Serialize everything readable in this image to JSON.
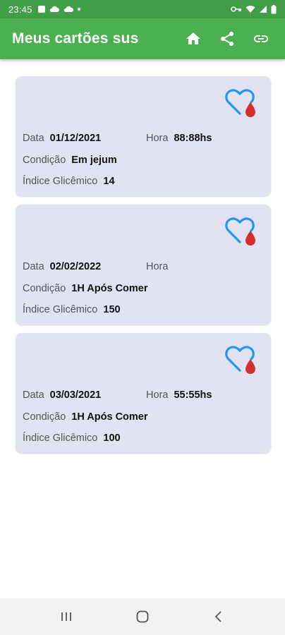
{
  "status_bar": {
    "time": "23:45",
    "icons": [
      "image-icon",
      "cloud-off-icon",
      "cloud-icon",
      "dot-icon",
      "vpn-key-icon",
      "wifi-icon",
      "signal-icon",
      "battery-icon"
    ]
  },
  "app_bar": {
    "title": "Meus cartões sus",
    "actions": [
      "home-icon",
      "share-icon",
      "link-icon"
    ]
  },
  "labels": {
    "data": "Data",
    "hora": "Hora",
    "condicao": "Condição",
    "indice": "Índice Glicêmico"
  },
  "cards": [
    {
      "data": "01/12/2021",
      "hora": "88:88hs",
      "condicao": "Em jejum",
      "indice": "14"
    },
    {
      "data": "02/02/2022",
      "hora": "",
      "condicao": "1H Após Comer",
      "indice": "150"
    },
    {
      "data": "03/03/2021",
      "hora": "55:55hs",
      "condicao": "1H Após Comer",
      "indice": "100"
    }
  ],
  "colors": {
    "app_bar": "#4caf50",
    "status_bar": "#3f9e46",
    "card_bg": "#e1e3f2",
    "heart_outline": "#2196f3",
    "blood_drop": "#d32f2f"
  },
  "nav_bar": {
    "buttons": [
      "recents-icon",
      "home-circle-icon",
      "back-icon"
    ]
  }
}
